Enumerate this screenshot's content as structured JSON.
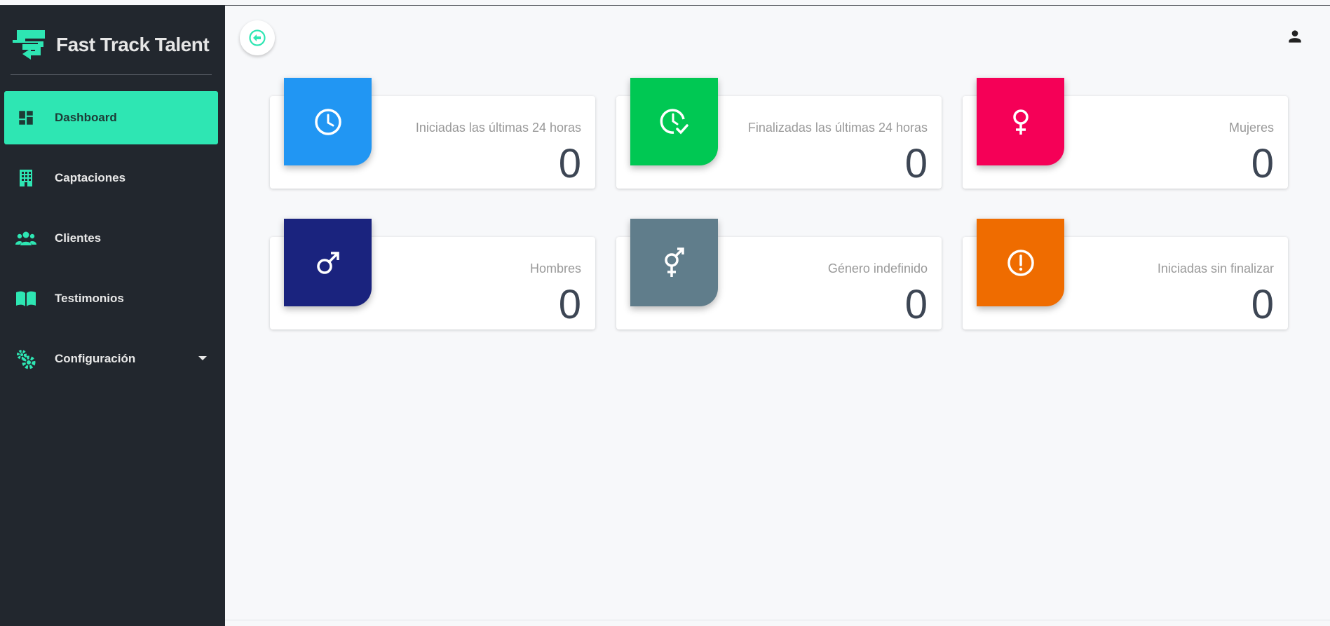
{
  "brand": {
    "name": "Fast Track Talent",
    "accent": "#2ee6b3"
  },
  "sidebar": {
    "background": "#22272e",
    "items": [
      {
        "label": "Dashboard",
        "icon": "dashboard-icon",
        "active": true
      },
      {
        "label": "Captaciones",
        "icon": "building-icon"
      },
      {
        "label": "Clientes",
        "icon": "people-icon"
      },
      {
        "label": "Testimonios",
        "icon": "book-icon"
      },
      {
        "label": "Configuración",
        "icon": "gears-icon",
        "has_dropdown": true
      }
    ]
  },
  "header": {
    "collapse_icon": "arrow-left-circle-icon",
    "user_icon": "user-icon"
  },
  "stats": [
    {
      "label": "Iniciadas las últimas 24 horas",
      "value": "0",
      "color": "#2196f3",
      "icon": "clock-icon"
    },
    {
      "label": "Finalizadas las últimas 24 horas",
      "value": "0",
      "color": "#00c853",
      "icon": "clock-check-icon"
    },
    {
      "label": "Mujeres",
      "value": "0",
      "color": "#f50057",
      "icon": "female-icon"
    },
    {
      "label": "Hombres",
      "value": "0",
      "color": "#1a237e",
      "icon": "male-icon"
    },
    {
      "label": "Género indefinido",
      "value": "0",
      "color": "#607d8b",
      "icon": "gender-neutral-icon"
    },
    {
      "label": "Iniciadas sin finalizar",
      "value": "0",
      "color": "#ef6c00",
      "icon": "alert-circle-icon"
    }
  ]
}
